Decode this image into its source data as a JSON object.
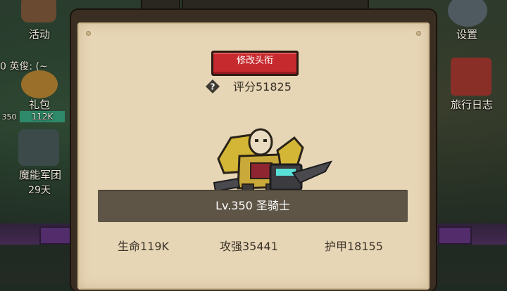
{
  "background": {
    "left_menu": [
      {
        "label": "活动",
        "icon": "event-icon"
      },
      {
        "label": "0 英俊: (~",
        "icon": ""
      },
      {
        "label": "礼包",
        "icon": "gift-icon"
      },
      {
        "label": "112K",
        "icon": ""
      },
      {
        "label": "350",
        "icon": ""
      },
      {
        "label": "魔能军团",
        "icon": "legion-icon"
      },
      {
        "label": "29天",
        "icon": ""
      }
    ],
    "right_menu": [
      {
        "label": "设置",
        "icon": "gear-icon"
      },
      {
        "label": "旅行日志",
        "icon": "journal-icon"
      }
    ]
  },
  "modal": {
    "rename_title_button": "修改头衔",
    "score_text": "评分51825",
    "level_text": "Lv.350 圣骑士",
    "stats": {
      "hp": "生命119K",
      "attack": "攻强35441",
      "armor": "护甲18155"
    }
  },
  "colors": {
    "paper": "#e7d6b6",
    "button_red": "#c72a2e",
    "level_bar": "#5e5546",
    "text_dark": "#3a3328"
  }
}
